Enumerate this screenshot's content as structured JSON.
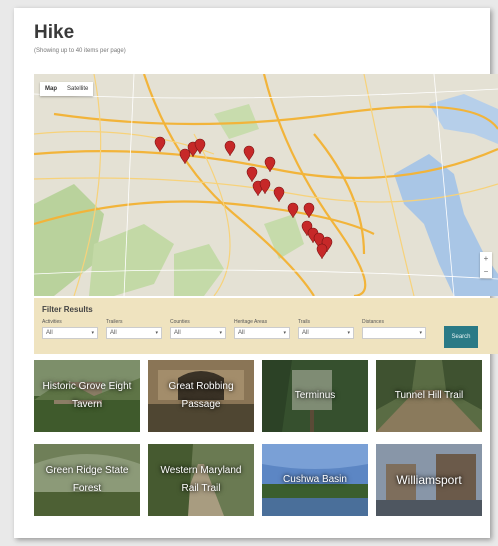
{
  "page": {
    "title": "Hike",
    "subtitle": "(Showing up to 40 items per page)"
  },
  "map": {
    "tabs": [
      "Map",
      "Satellite"
    ],
    "active_tab": "Map",
    "zoom_in": "+",
    "zoom_out": "−",
    "marker_color": "#c62828",
    "marker_count": 18
  },
  "filter": {
    "title": "Filter Results",
    "fields": [
      {
        "label": "Activities",
        "value": "All"
      },
      {
        "label": "Trailers",
        "value": "All"
      },
      {
        "label": "Counties",
        "value": "All"
      },
      {
        "label": "Heritage Areas",
        "value": "All"
      },
      {
        "label": "Trails",
        "value": "All"
      },
      {
        "label": "Distances",
        "value": ""
      }
    ],
    "search_label": "Search"
  },
  "results": [
    {
      "label": "Historic Grove Eight Tavern",
      "color": "#4f6b3a"
    },
    {
      "label": "Great Robbing Passage",
      "color": "#6e5a3c"
    },
    {
      "label": "Terminus",
      "color": "#3e5a3a"
    },
    {
      "label": "Tunnel Hill Trail",
      "color": "#4a5f38"
    },
    {
      "label": "Green Ridge State Forest",
      "color": "#5a6a46"
    },
    {
      "label": "Western Maryland Rail Trail",
      "color": "#55663f"
    },
    {
      "label": "Cushwa Basin",
      "color": "#3d6aa8"
    },
    {
      "label": "Williamsport",
      "color": "#5c6470"
    }
  ]
}
